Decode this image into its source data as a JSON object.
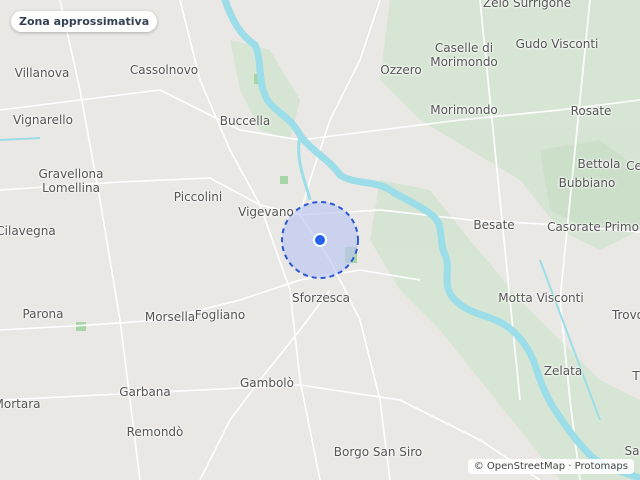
{
  "badge": {
    "label": "Zona approssimativa"
  },
  "places": [
    {
      "name": "Zelo Surrigone"
    },
    {
      "name": "Villanova"
    },
    {
      "name": "Cassolnovo"
    },
    {
      "name": "Ozzero"
    },
    {
      "name": "Caselle di\nMorimondo"
    },
    {
      "name": "Gudo Visconti"
    },
    {
      "name": "Vignarello"
    },
    {
      "name": "Buccella"
    },
    {
      "name": "Morimondo"
    },
    {
      "name": "Rosate"
    },
    {
      "name": "Gravellona\nLomellina"
    },
    {
      "name": "Piccolini"
    },
    {
      "name": "Vigevano"
    },
    {
      "name": "Bettola"
    },
    {
      "name": "Bubbiano"
    },
    {
      "name": "Cilavegna"
    },
    {
      "name": "Besate"
    },
    {
      "name": "Casorate Primo"
    },
    {
      "name": "Parona"
    },
    {
      "name": "Morsella"
    },
    {
      "name": "Fogliano"
    },
    {
      "name": "Sforzesca"
    },
    {
      "name": "Motta Visconti"
    },
    {
      "name": "Trovo"
    },
    {
      "name": "Zelata"
    },
    {
      "name": "Garbana"
    },
    {
      "name": "Gambolò"
    },
    {
      "name": "Mortara"
    },
    {
      "name": "Remondò"
    },
    {
      "name": "Borgo San Siro"
    },
    {
      "name": "Sa"
    },
    {
      "name": "Ce"
    },
    {
      "name": "T"
    }
  ],
  "attribution": {
    "copyright": "© OpenStreetMap",
    "separator": " · ",
    "provider": "Protomaps"
  },
  "colors": {
    "land": "#e9e8e5",
    "water": "#9bdde8",
    "park": "#cfe3cf",
    "area_fill": "#bcc6f2",
    "area_stroke": "#2b59d6",
    "marker": "#2563eb"
  }
}
